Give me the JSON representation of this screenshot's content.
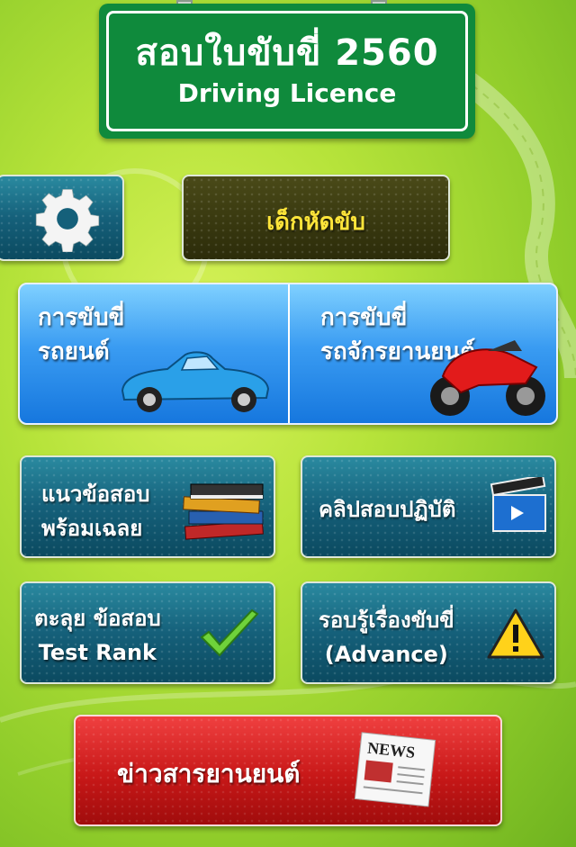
{
  "sign": {
    "title": "สอบใบขับขี่ 2560",
    "subtitle": "Driving Licence"
  },
  "menu": {
    "student_driver": "เด็กหัดขับ",
    "car": {
      "line1": "การขับขี่",
      "line2": "รถยนต์"
    },
    "motorcycle": {
      "line1": "การขับขี่",
      "line2": "รถจักรยานยนต์"
    },
    "exam_answers": {
      "line1": "แนวข้อสอบ",
      "line2": "พร้อมเฉลย"
    },
    "exam_clips": "คลิปสอบปฏิบัติ",
    "test_rank": {
      "line1": "ตะลุย ข้อสอบ",
      "line2": "Test Rank"
    },
    "advance": {
      "line1": "รอบรู้เรื่องขับขี่",
      "line2": "(Advance)"
    },
    "news": "ข่าวสารยานยนต์",
    "newspaper_masthead": "NEWS"
  },
  "colors": {
    "sign_green": "#0f8a3c",
    "tile_teal": "#15607a",
    "panel_blue": "#3a9cf2",
    "news_red": "#c81818",
    "student_yellow": "#ffe53a"
  },
  "icons": [
    "gear-icon",
    "car-image",
    "motorcycle-image",
    "books-icon",
    "clapperboard-icon",
    "checkmark-icon",
    "warning-icon",
    "newspaper-icon"
  ]
}
